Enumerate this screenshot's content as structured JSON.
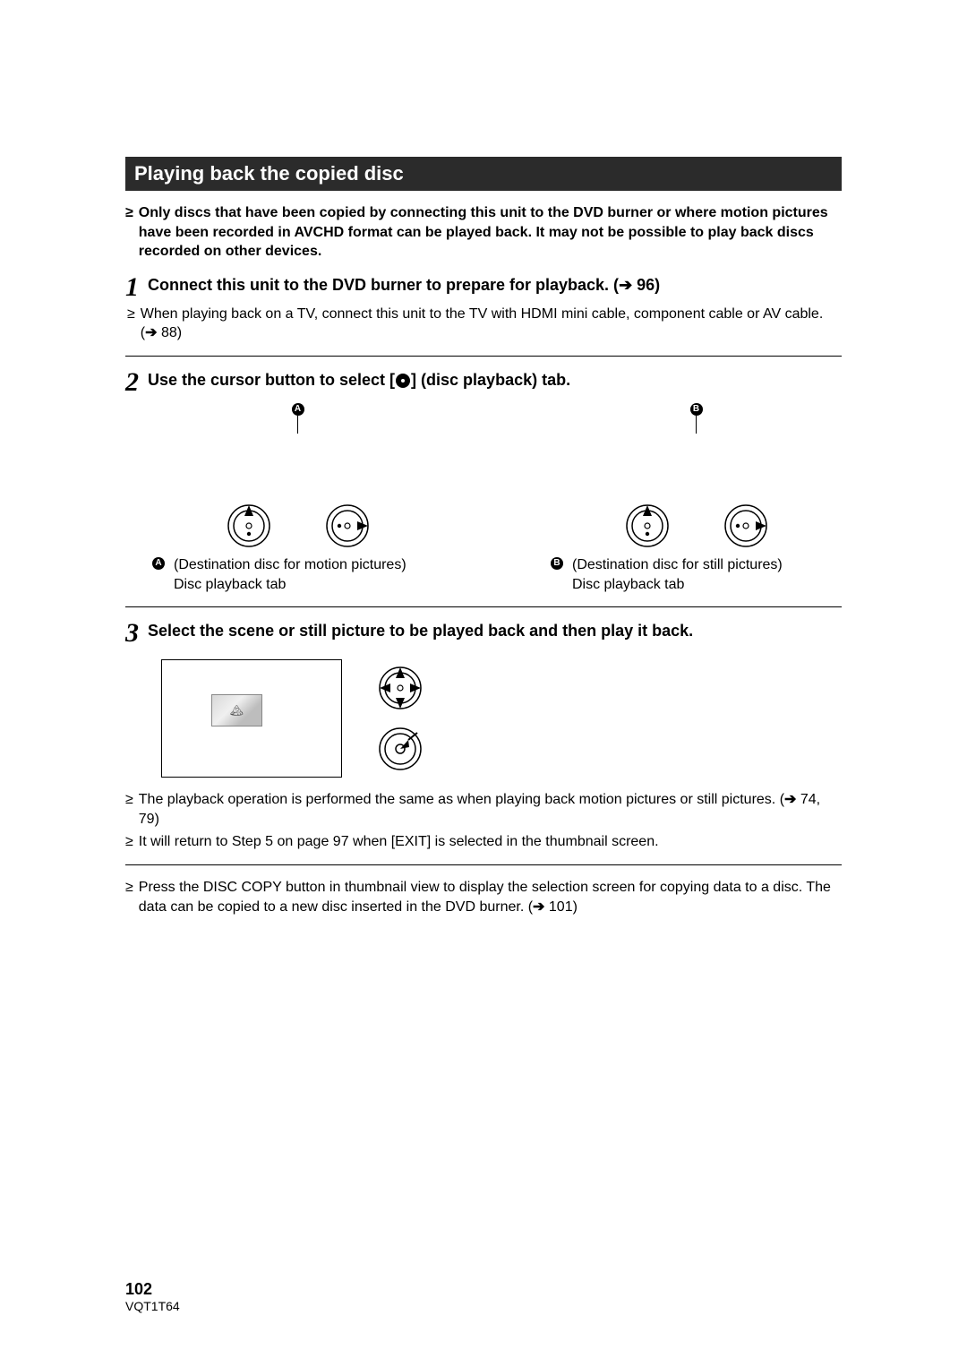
{
  "header": "Playing back the copied disc",
  "intro": "Only discs that have been copied by connecting this unit to the DVD burner or where motion pictures have been recorded in AVCHD format can be played back. It may not be possible to play back discs recorded on other devices.",
  "step1": {
    "num": "1",
    "title_pre": "Connect this unit to the DVD burner to prepare for playback. (",
    "title_post": " 96)",
    "sub_pre": "When playing back on a TV, connect this unit to the TV with HDMI mini cable, component cable or AV cable. (",
    "sub_post": " 88)"
  },
  "step2": {
    "num": "2",
    "title_pre": "Use the cursor button to select [",
    "title_post": "] (disc playback) tab.",
    "markerA": "A",
    "markerB": "B",
    "descA_line1": "(Destination disc for motion pictures)",
    "descA_line2": "Disc playback tab",
    "descB_line1": "(Destination disc for still pictures)",
    "descB_line2": "Disc playback tab"
  },
  "step3": {
    "num": "3",
    "title": "Select the scene or still picture to be played back and then play it back.",
    "note1_pre": "The playback operation is performed the same as when playing back motion pictures or still pictures. (",
    "note1_post": " 74, 79)",
    "note2": "It will return to Step 5 on page 97 when [EXIT] is selected in the thumbnail screen.",
    "note3_pre": "Press the DISC COPY button in thumbnail view to display the selection screen for copying data to a disc. The data can be copied to a new disc inserted in the DVD burner. (",
    "note3_post": " 101)"
  },
  "footer": {
    "page": "102",
    "code": "VQT1T64"
  }
}
